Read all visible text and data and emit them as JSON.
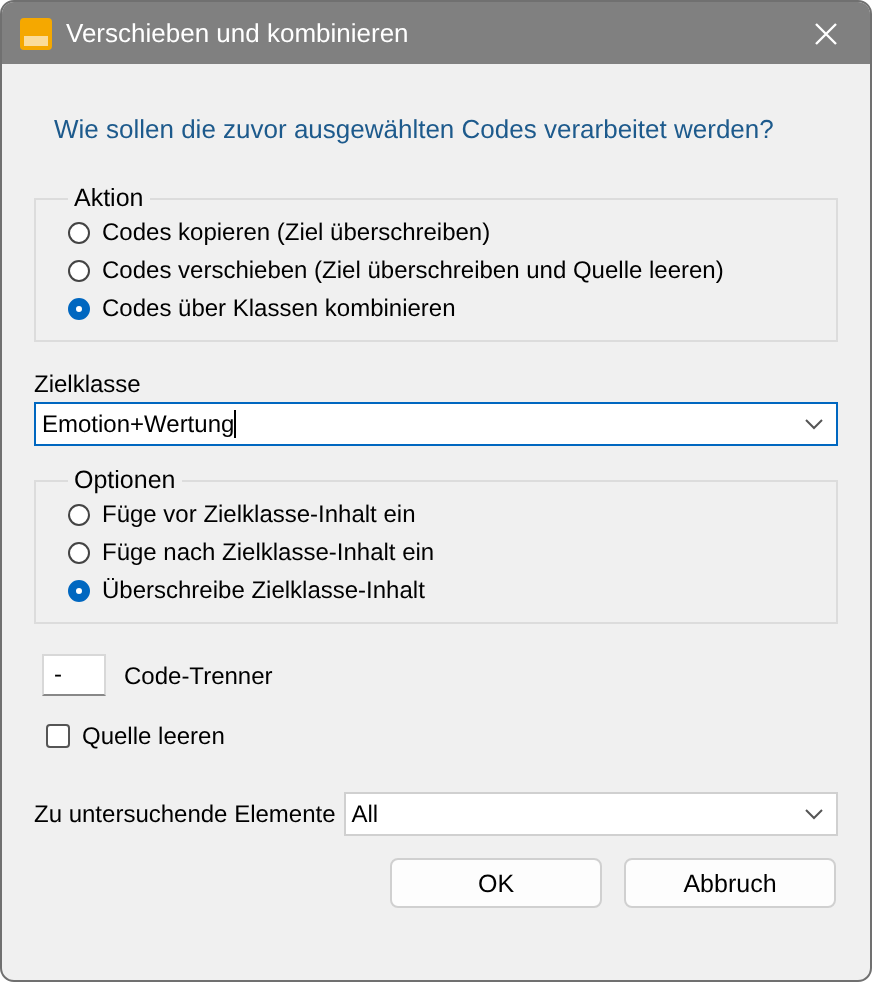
{
  "window": {
    "title": "Verschieben und kombinieren"
  },
  "question": "Wie sollen die zuvor ausgewählten Codes verarbeitet werden?",
  "action_group": {
    "title": "Aktion",
    "options": [
      {
        "label": "Codes kopieren (Ziel überschreiben)",
        "selected": false
      },
      {
        "label": "Codes verschieben (Ziel überschreiben und Quelle leeren)",
        "selected": false
      },
      {
        "label": "Codes über Klassen kombinieren",
        "selected": true
      }
    ]
  },
  "target_class": {
    "label": "Zielklasse",
    "value": "Emotion+Wertung"
  },
  "options_group": {
    "title": "Optionen",
    "options": [
      {
        "label": "Füge vor Zielklasse-Inhalt ein",
        "selected": false
      },
      {
        "label": "Füge nach Zielklasse-Inhalt ein",
        "selected": false
      },
      {
        "label": "Überschreibe Zielklasse-Inhalt",
        "selected": true
      }
    ]
  },
  "separator": {
    "value": "-",
    "label": "Code-Trenner"
  },
  "clear_source": {
    "label": "Quelle leeren",
    "checked": false
  },
  "elements": {
    "label": "Zu untersuchende Elemente",
    "value": "All"
  },
  "buttons": [
    "OK",
    "Abbruch"
  ]
}
